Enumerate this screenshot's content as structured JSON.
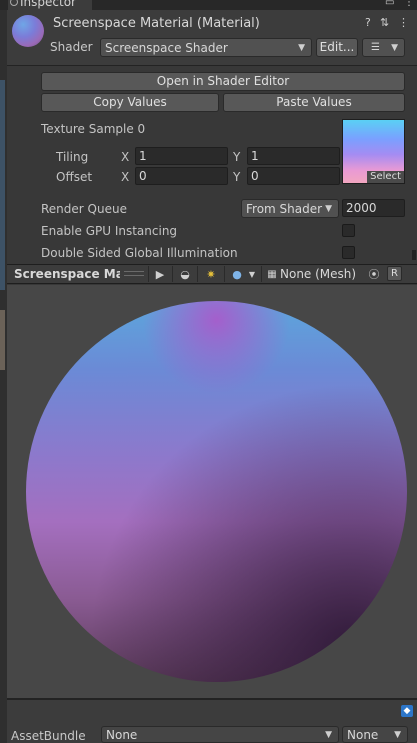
{
  "window": {
    "tab_title": "Inspector",
    "tab_menu_icons": [
      "lock-icon",
      "kebab-menu-icon"
    ]
  },
  "header": {
    "title": "Screenspace Material (Material)",
    "shader_label": "Shader",
    "shader_value": "Screenspace Shader",
    "edit_button": "Edit...",
    "help_icon": "?",
    "settings_icon": "⇅",
    "more_icon": "⋮"
  },
  "actions": {
    "open_shader_editor": "Open in Shader Editor",
    "copy_values": "Copy Values",
    "paste_values": "Paste Values"
  },
  "texture": {
    "label": "Texture Sample 0",
    "select_label": "Select",
    "tiling_label": "Tiling",
    "offset_label": "Offset",
    "x_label": "X",
    "y_label": "Y",
    "tiling_x": "1",
    "tiling_y": "1",
    "offset_x": "0",
    "offset_y": "0"
  },
  "render": {
    "render_queue_label": "Render Queue",
    "render_queue_mode": "From Shader",
    "render_queue_value": "2000",
    "gpu_instancing_label": "Enable GPU Instancing",
    "gpu_instancing_checked": false,
    "double_sided_gi_label": "Double Sided Global Illumination",
    "double_sided_gi_checked": false
  },
  "preview": {
    "title": "Screenspace Material",
    "mesh_value": "None (Mesh)",
    "r_label": "R"
  },
  "footer": {
    "assetbundle_label": "AssetBundle",
    "assetbundle_value": "None",
    "variant_value": "None"
  }
}
